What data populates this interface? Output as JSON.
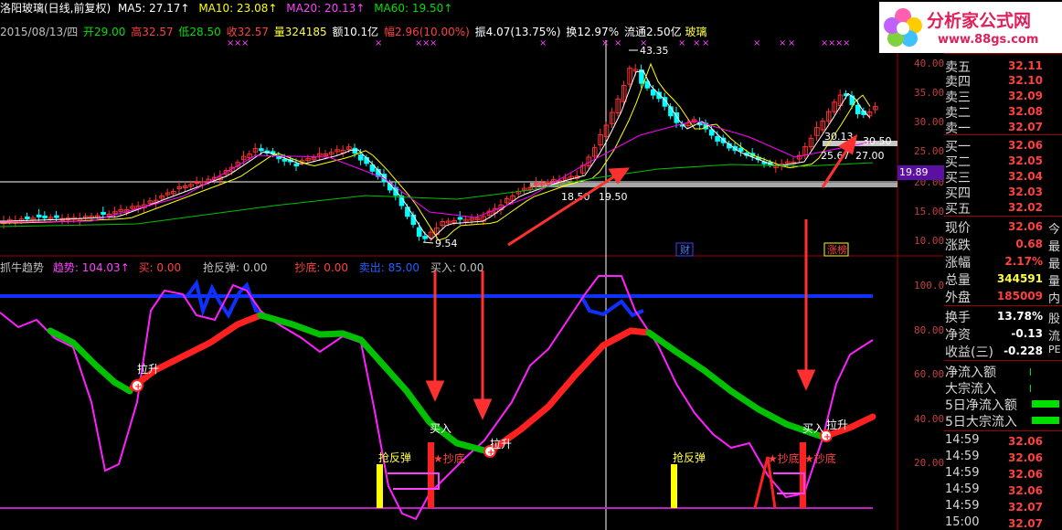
{
  "header_top": {
    "stock_name": "洛阳玻璃(日线,前复权)",
    "ma5": "MA5: 27.17↑",
    "ma10": "MA10: 23.08↑",
    "ma20": "MA20: 20.13↑",
    "ma60": "MA60: 19.50↑"
  },
  "header_second": {
    "date": "2015/08/13/四",
    "open": "开29.00",
    "high": "高32.57",
    "low": "低28.50",
    "close": "收32.57",
    "volume": "量324185",
    "amount": "额10.1亿",
    "change": "幅2.96(10.00%)",
    "amplitude": "振4.07(13.75%)",
    "turnover": "换12.97%",
    "float": "流通2.50亿",
    "sector": "玻璃"
  },
  "logo": {
    "title": "分析家公式网",
    "url_text": "www.88gs.com"
  },
  "price_chart": {
    "annotations": {
      "high": "43.35",
      "low": "9.54",
      "mid1": "18.50",
      "mid2": "19.50",
      "right1": "25.67",
      "right2": "27.00",
      "right3": "30.13",
      "right4": "30.50",
      "price_tag": "19.89"
    },
    "axis_ticks": [
      "40.00",
      "35.00",
      "30.00",
      "25.00",
      "20.00",
      "15.00",
      "10.00"
    ],
    "badges": [
      "财",
      "涨榜"
    ]
  },
  "indicator": {
    "name": "抓牛趋势",
    "trend": "趋势: 104.03↑",
    "buy": "买: 0.00",
    "rebound": "抢反弹: 0.00",
    "bottom": "抄底: 0.00",
    "sell": "卖出: 85.00",
    "buy_in": "买入: 0.00",
    "axis_ticks": [
      "100.0",
      "80.00",
      "60.00",
      "40.00",
      "20.00"
    ],
    "labels": {
      "lashen": "拉升",
      "mairu": "买入",
      "qiangfantan": "抢反弹",
      "chaodi": "★抄底"
    }
  },
  "order_book": {
    "asks": [
      {
        "label": "卖五",
        "price": "32.11"
      },
      {
        "label": "卖四",
        "price": "32.10"
      },
      {
        "label": "卖三",
        "price": "32.09"
      },
      {
        "label": "卖二",
        "price": "32.08"
      },
      {
        "label": "卖一",
        "price": "32.07"
      }
    ],
    "bids": [
      {
        "label": "买一",
        "price": "32.06"
      },
      {
        "label": "买二",
        "price": "32.05"
      },
      {
        "label": "买三",
        "price": "32.04"
      },
      {
        "label": "买四",
        "price": "32.03"
      },
      {
        "label": "买五",
        "price": "32.02"
      }
    ]
  },
  "quote": [
    {
      "label": "现价",
      "value": "32.06",
      "extra": "今"
    },
    {
      "label": "涨跌",
      "value": "0.68",
      "extra": "最"
    },
    {
      "label": "涨幅",
      "value": "2.17%",
      "extra": "最"
    },
    {
      "label": "总量",
      "value": "344591",
      "extra": "量"
    },
    {
      "label": "外盘",
      "value": "185009",
      "extra": "内"
    }
  ],
  "stats": [
    {
      "label": "换手",
      "value": "13.78%",
      "extra": "股"
    },
    {
      "label": "净资",
      "value": "-0.13",
      "extra": "流"
    },
    {
      "label": "收益(三)",
      "value": "-0.228",
      "extra": "PE"
    }
  ],
  "flows": [
    {
      "label": "净流入额"
    },
    {
      "label": "大宗流入"
    },
    {
      "label": "5日净流入额"
    },
    {
      "label": "5日大宗流入"
    }
  ],
  "ticks": [
    {
      "time": "14:59",
      "price": "32.06"
    },
    {
      "time": "14:59",
      "price": "32.06"
    },
    {
      "time": "14:59",
      "price": "32.06"
    },
    {
      "time": "14:59",
      "price": "32.06"
    },
    {
      "time": "14:59",
      "price": "32.07"
    },
    {
      "time": "15:00",
      "price": "32.07"
    }
  ],
  "colors": {
    "up": "#ff3030",
    "down": "#00ffff",
    "ma5": "#ffffff",
    "ma10": "#ffff00",
    "ma20": "#ff00ff",
    "ma60": "#00c000"
  }
}
